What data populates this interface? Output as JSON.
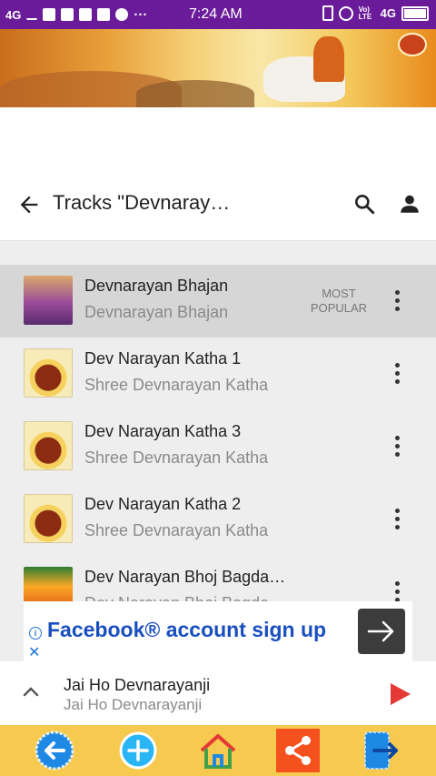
{
  "status_bar": {
    "network": "4G",
    "time": "7:24 AM",
    "right_network": "4G",
    "volte_label": "Vo) LTE"
  },
  "toolbar": {
    "title": "Tracks \"Devnaray…"
  },
  "tracks": [
    {
      "title": "Devnarayan Bhajan",
      "subtitle": "Devnarayan Bhajan",
      "badge_line1": "MOST",
      "badge_line2": "POPULAR"
    },
    {
      "title": "Dev Narayan Katha 1",
      "subtitle": "Shree Devnarayan Katha"
    },
    {
      "title": "Dev Narayan Katha 3",
      "subtitle": "Shree Devnarayan Katha"
    },
    {
      "title": "Dev Narayan Katha 2",
      "subtitle": "Shree Devnarayan Katha"
    },
    {
      "title": "Dev Narayan Bhoj Bagda…",
      "subtitle": "Dev Narayan Bhoj Bagda…"
    }
  ],
  "ad": {
    "headline": "Facebook® account sign up"
  },
  "now_playing": {
    "title": "Jai Ho Devnarayanji",
    "subtitle": "Jai Ho Devnarayanji"
  },
  "colors": {
    "status_bar": "#6a1b9a",
    "bottom_bar": "#f6c94f",
    "play": "#e53935",
    "ad_text": "#1a4fbf",
    "share_button": "#f4511e"
  },
  "icons": {
    "bottom_bar": [
      "back-arrow-icon",
      "add-icon",
      "home-icon",
      "share-icon",
      "exit-icon"
    ]
  }
}
